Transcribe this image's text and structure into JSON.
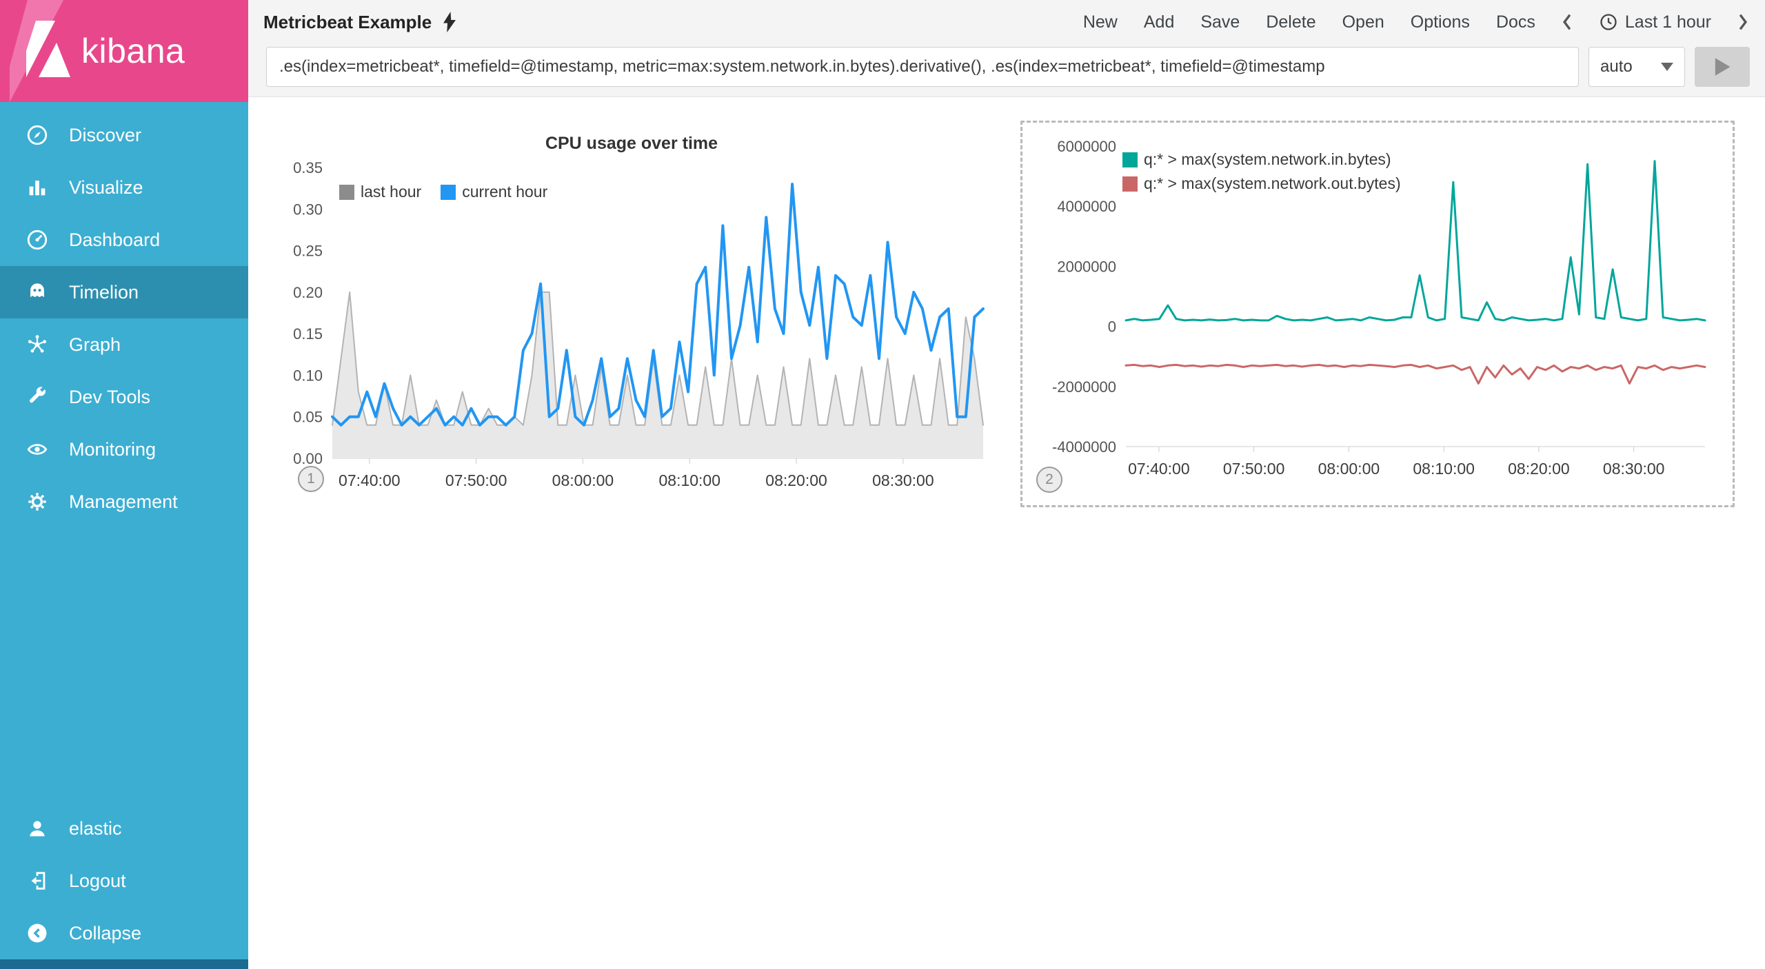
{
  "sidebar": {
    "logo_text": "kibana",
    "items": [
      {
        "label": "Discover"
      },
      {
        "label": "Visualize"
      },
      {
        "label": "Dashboard"
      },
      {
        "label": "Timelion"
      },
      {
        "label": "Graph"
      },
      {
        "label": "Dev Tools"
      },
      {
        "label": "Monitoring"
      },
      {
        "label": "Management"
      }
    ],
    "footer_items": [
      {
        "label": "elastic"
      },
      {
        "label": "Logout"
      },
      {
        "label": "Collapse"
      }
    ]
  },
  "header": {
    "title": "Metricbeat Example",
    "nav": [
      "New",
      "Add",
      "Save",
      "Delete",
      "Open",
      "Options",
      "Docs"
    ],
    "time_label": "Last 1 hour"
  },
  "query": {
    "value": ".es(index=metricbeat*, timefield=@timestamp, metric=max:system.network.in.bytes).derivative(), .es(index=metricbeat*, timefield=@timestamp",
    "interval": "auto"
  },
  "panel_badges": [
    "1",
    "2"
  ],
  "chart_data": [
    {
      "type": "line",
      "title": "CPU usage over time",
      "xlabel": "",
      "ylabel": "",
      "ylim": [
        0,
        0.35
      ],
      "grid": false,
      "legend_position": "top-left",
      "yticks": [
        {
          "v": 0.0,
          "label": "0.00"
        },
        {
          "v": 0.05,
          "label": "0.05"
        },
        {
          "v": 0.1,
          "label": "0.10"
        },
        {
          "v": 0.15,
          "label": "0.15"
        },
        {
          "v": 0.2,
          "label": "0.20"
        },
        {
          "v": 0.25,
          "label": "0.25"
        },
        {
          "v": 0.3,
          "label": "0.30"
        },
        {
          "v": 0.35,
          "label": "0.35"
        }
      ],
      "xticks": [
        {
          "pos": 0.057,
          "label": "07:40:00"
        },
        {
          "pos": 0.221,
          "label": "07:50:00"
        },
        {
          "pos": 0.385,
          "label": "08:00:00"
        },
        {
          "pos": 0.549,
          "label": "08:10:00"
        },
        {
          "pos": 0.713,
          "label": "08:20:00"
        },
        {
          "pos": 0.877,
          "label": "08:30:00"
        }
      ],
      "series": [
        {
          "name": "last hour",
          "color": "#b3b3b3",
          "legend_color": "#8c8c8c",
          "width": 2,
          "fill": "#e8e8e8",
          "values": [
            0.04,
            0.12,
            0.2,
            0.08,
            0.04,
            0.04,
            0.09,
            0.04,
            0.04,
            0.1,
            0.04,
            0.04,
            0.07,
            0.04,
            0.04,
            0.08,
            0.04,
            0.04,
            0.06,
            0.04,
            0.04,
            0.05,
            0.04,
            0.1,
            0.2,
            0.2,
            0.04,
            0.04,
            0.1,
            0.04,
            0.04,
            0.11,
            0.04,
            0.04,
            0.1,
            0.04,
            0.04,
            0.12,
            0.04,
            0.04,
            0.1,
            0.04,
            0.04,
            0.11,
            0.04,
            0.04,
            0.12,
            0.04,
            0.04,
            0.1,
            0.04,
            0.04,
            0.11,
            0.04,
            0.04,
            0.12,
            0.04,
            0.04,
            0.1,
            0.04,
            0.04,
            0.11,
            0.04,
            0.04,
            0.12,
            0.04,
            0.04,
            0.1,
            0.04,
            0.04,
            0.12,
            0.04,
            0.04,
            0.17,
            0.12,
            0.04
          ]
        },
        {
          "name": "current hour",
          "color": "#2196f3",
          "width": 4,
          "values": [
            0.05,
            0.04,
            0.05,
            0.05,
            0.08,
            0.05,
            0.09,
            0.06,
            0.04,
            0.05,
            0.04,
            0.05,
            0.06,
            0.04,
            0.05,
            0.04,
            0.06,
            0.04,
            0.05,
            0.05,
            0.04,
            0.05,
            0.13,
            0.15,
            0.21,
            0.05,
            0.06,
            0.13,
            0.05,
            0.04,
            0.07,
            0.12,
            0.05,
            0.06,
            0.12,
            0.07,
            0.05,
            0.13,
            0.05,
            0.06,
            0.14,
            0.08,
            0.21,
            0.23,
            0.1,
            0.28,
            0.12,
            0.16,
            0.23,
            0.14,
            0.29,
            0.18,
            0.15,
            0.33,
            0.2,
            0.16,
            0.23,
            0.12,
            0.22,
            0.21,
            0.17,
            0.16,
            0.22,
            0.12,
            0.26,
            0.17,
            0.15,
            0.2,
            0.18,
            0.13,
            0.17,
            0.18,
            0.05,
            0.05,
            0.17,
            0.18
          ]
        }
      ]
    },
    {
      "type": "line",
      "title": "",
      "xlabel": "",
      "ylabel": "",
      "ylim": [
        -4000000,
        6000000
      ],
      "grid": false,
      "legend_position": "top-left",
      "yticks": [
        {
          "v": 6000000,
          "label": "6000000"
        },
        {
          "v": 4000000,
          "label": "4000000"
        },
        {
          "v": 2000000,
          "label": "2000000"
        },
        {
          "v": 0,
          "label": "0"
        },
        {
          "v": -2000000,
          "label": "-2000000"
        },
        {
          "v": -4000000,
          "label": "-4000000"
        }
      ],
      "xticks": [
        {
          "pos": 0.057,
          "label": "07:40:00"
        },
        {
          "pos": 0.221,
          "label": "07:50:00"
        },
        {
          "pos": 0.385,
          "label": "08:00:00"
        },
        {
          "pos": 0.549,
          "label": "08:10:00"
        },
        {
          "pos": 0.713,
          "label": "08:20:00"
        },
        {
          "pos": 0.877,
          "label": "08:30:00"
        }
      ],
      "series": [
        {
          "name": "q:* > max(system.network.in.bytes)",
          "color": "#00a69a",
          "width": 3,
          "values": [
            200000,
            250000,
            200000,
            220000,
            250000,
            700000,
            250000,
            200000,
            220000,
            200000,
            230000,
            200000,
            210000,
            250000,
            200000,
            220000,
            200000,
            200000,
            350000,
            250000,
            200000,
            220000,
            200000,
            250000,
            300000,
            200000,
            220000,
            250000,
            200000,
            300000,
            250000,
            200000,
            220000,
            300000,
            300000,
            1700000,
            300000,
            200000,
            250000,
            4800000,
            300000,
            250000,
            200000,
            800000,
            250000,
            200000,
            300000,
            250000,
            200000,
            220000,
            250000,
            200000,
            250000,
            2300000,
            400000,
            5400000,
            300000,
            250000,
            1900000,
            300000,
            250000,
            200000,
            250000,
            5500000,
            300000,
            250000,
            200000,
            220000,
            250000,
            200000
          ]
        },
        {
          "name": "q:* > max(system.network.out.bytes)",
          "color": "#cb6666",
          "width": 3,
          "values": [
            -1300000,
            -1280000,
            -1320000,
            -1300000,
            -1350000,
            -1300000,
            -1280000,
            -1320000,
            -1300000,
            -1340000,
            -1300000,
            -1320000,
            -1280000,
            -1300000,
            -1350000,
            -1300000,
            -1320000,
            -1300000,
            -1280000,
            -1320000,
            -1300000,
            -1340000,
            -1300000,
            -1280000,
            -1320000,
            -1300000,
            -1350000,
            -1300000,
            -1320000,
            -1280000,
            -1300000,
            -1320000,
            -1350000,
            -1300000,
            -1280000,
            -1350000,
            -1300000,
            -1400000,
            -1350000,
            -1300000,
            -1450000,
            -1350000,
            -1900000,
            -1350000,
            -1700000,
            -1300000,
            -1600000,
            -1400000,
            -1750000,
            -1350000,
            -1450000,
            -1300000,
            -1500000,
            -1350000,
            -1400000,
            -1300000,
            -1450000,
            -1350000,
            -1400000,
            -1300000,
            -1900000,
            -1350000,
            -1400000,
            -1300000,
            -1450000,
            -1350000,
            -1400000,
            -1350000,
            -1300000,
            -1350000
          ]
        }
      ]
    }
  ]
}
